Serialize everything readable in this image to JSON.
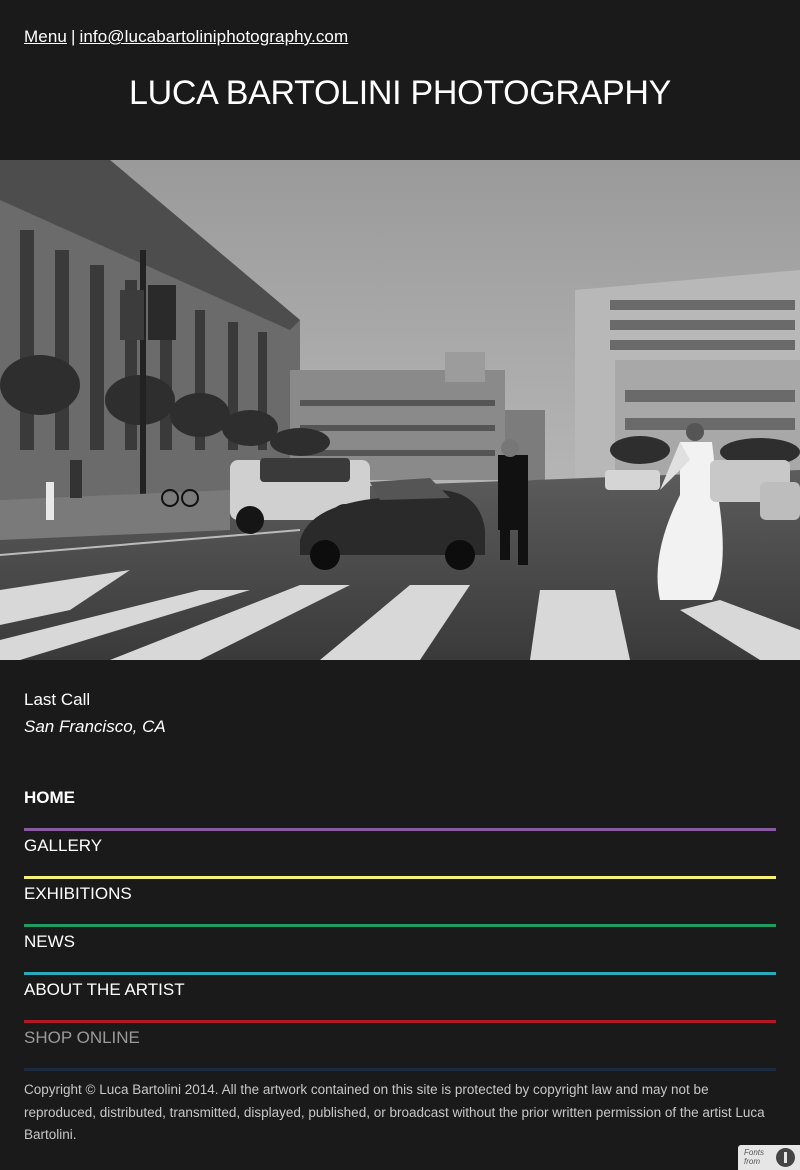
{
  "header": {
    "menu_label": "Menu",
    "separator": "|",
    "email": "info@lucabartoliniphotography.com",
    "site_title": "LUCA BARTOLINI PHOTOGRAPHY"
  },
  "hero": {
    "title": "Last Call",
    "location": "San Francisco, CA"
  },
  "nav": {
    "items": [
      {
        "label": "HOME",
        "color": "#8a5ba3"
      },
      {
        "label": "GALLERY",
        "color": "#f6f07a"
      },
      {
        "label": "EXHIBITIONS",
        "color": "#1f9c62"
      },
      {
        "label": "NEWS",
        "color": "#2aa9b8"
      },
      {
        "label": "ABOUT THE ARTIST",
        "color": "#b01822"
      },
      {
        "label": "SHOP ONLINE",
        "color": "#1c2a40"
      }
    ]
  },
  "footer": {
    "copyright": "Copyright © Luca Bartolini 2014. All the artwork contained on this site is protected by copyright law and may not be reproduced, distributed, transmitted, displayed, published, or broadcast without the prior written permission of the artist Luca Bartolini.",
    "badge_text_line1": "Fonts",
    "badge_text_line2": "from"
  }
}
